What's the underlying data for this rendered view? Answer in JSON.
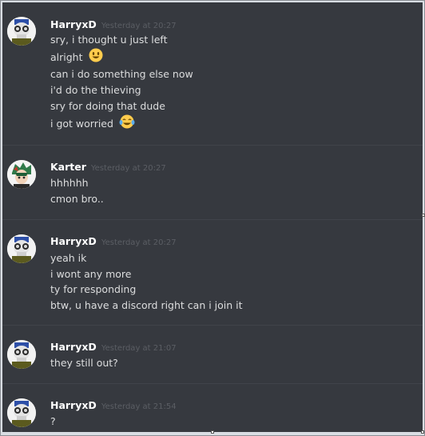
{
  "groups": [
    {
      "author": "HarryxD",
      "timestamp": "Yesterday at 20:27",
      "avatar": "skull-goggles-avatar",
      "messages": [
        {
          "text": "sry, i thought u just left"
        },
        {
          "text": "alright",
          "emoji": "smiley-emoji"
        },
        {
          "text": "can i do something else now"
        },
        {
          "text": "i'd do the thieving"
        },
        {
          "text": "sry for doing that dude"
        },
        {
          "text": "i got worried",
          "emoji": "joy-emoji"
        }
      ]
    },
    {
      "author": "Karter",
      "timestamp": "Yesterday at 20:27",
      "avatar": "anime-character-avatar",
      "messages": [
        {
          "text": "hhhhhh"
        },
        {
          "text": "cmon bro.."
        }
      ]
    },
    {
      "author": "HarryxD",
      "timestamp": "Yesterday at 20:27",
      "avatar": "skull-goggles-avatar",
      "messages": [
        {
          "text": "yeah ik"
        },
        {
          "text": "i wont any more"
        },
        {
          "text": "ty for responding"
        },
        {
          "text": "btw, u have a discord right can i join it"
        }
      ]
    },
    {
      "author": "HarryxD",
      "timestamp": "Yesterday at 21:07",
      "avatar": "skull-goggles-avatar",
      "messages": [
        {
          "text": "they still out?"
        }
      ]
    },
    {
      "author": "HarryxD",
      "timestamp": "Yesterday at 21:54",
      "avatar": "skull-goggles-avatar",
      "messages": [
        {
          "text": "?"
        }
      ]
    }
  ],
  "colors": {
    "background": "#36393f",
    "author": "#ffffff",
    "timestamp": "#5b5e64",
    "message": "#dcddde"
  }
}
